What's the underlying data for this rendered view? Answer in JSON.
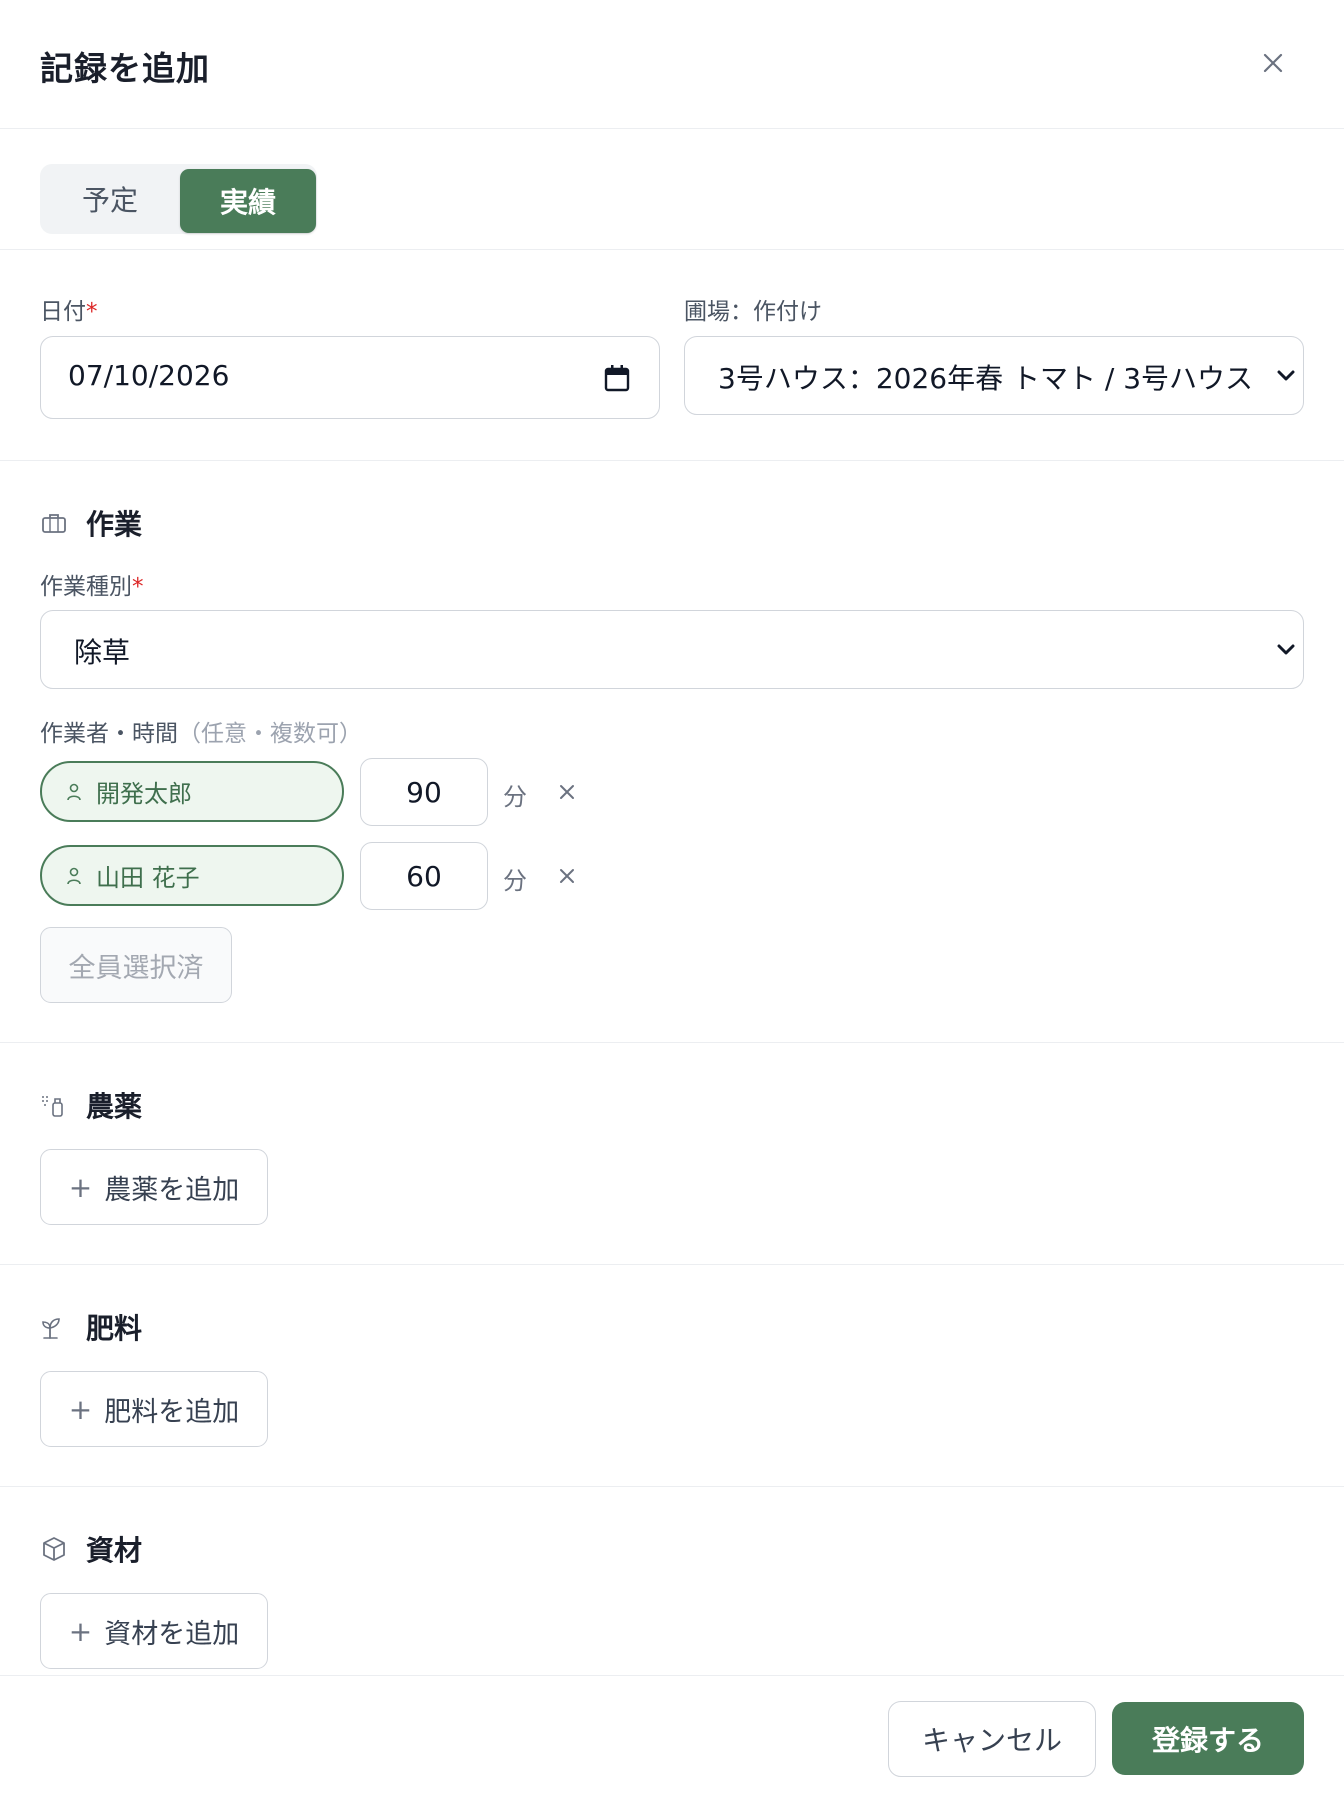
{
  "dialog": {
    "title": "記録を追加",
    "close_icon": "close-icon"
  },
  "mode_toggle": {
    "options": [
      "予定",
      "実績"
    ],
    "selected": "実績"
  },
  "date": {
    "label": "日付",
    "required_mark": "*",
    "value": "07/10/2026",
    "icon": "calendar-icon"
  },
  "plot": {
    "label": "圃場：作付け",
    "value": "3号ハウス：2026年春 トマト / 3号ハウス",
    "icon": "chevron-down-icon"
  },
  "work": {
    "title": "作業",
    "icon": "briefcase-icon",
    "type_label": "作業種別",
    "required_mark": "*",
    "type_value": "除草",
    "workers_label": "作業者・時間",
    "workers_hint": "（任意・複数可）",
    "workers": [
      {
        "name": "開発太郎",
        "minutes": "90",
        "unit": "分"
      },
      {
        "name": "山田 花子",
        "minutes": "60",
        "unit": "分"
      }
    ],
    "all_selected_label": "全員選択済"
  },
  "pesticide": {
    "title": "農薬",
    "icon": "spray-bottle-icon",
    "add_label": "農薬を追加"
  },
  "fertilizer": {
    "title": "肥料",
    "icon": "sprout-icon",
    "add_label": "肥料を追加"
  },
  "materials": {
    "title": "資材",
    "icon": "package-icon",
    "add_label": "資材を追加"
  },
  "footer": {
    "cancel_label": "キャンセル",
    "submit_label": "登録する"
  },
  "colors": {
    "accent": "#4a7c59",
    "accent_light": "#eef6ef",
    "required": "#dc2626",
    "border": "#d1d5db"
  }
}
